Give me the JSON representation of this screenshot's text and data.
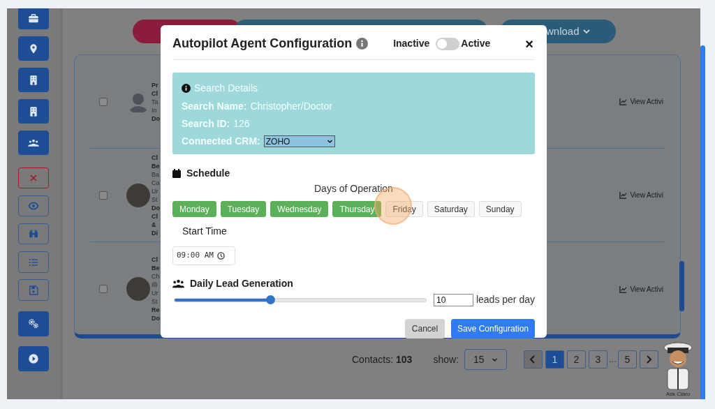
{
  "sidebar": {
    "items": [
      {
        "kind": "filled"
      },
      {
        "kind": "filled"
      },
      {
        "kind": "filled"
      },
      {
        "kind": "filled"
      },
      {
        "kind": "filled"
      },
      {
        "kind": "danger"
      },
      {
        "kind": "outlined"
      },
      {
        "kind": "outlined"
      },
      {
        "kind": "outlined"
      },
      {
        "kind": "outlined"
      },
      {
        "kind": "filled"
      },
      {
        "kind": "filled"
      }
    ]
  },
  "toolbar": {
    "buttons": [
      {
        "kind": "danger"
      },
      {
        "kind": "primary"
      },
      {
        "kind": "download",
        "label": "wnload"
      }
    ]
  },
  "contacts": {
    "rows": [
      {
        "checked": false,
        "kind": "silhouette",
        "lines": [
          {
            "text": "Pr",
            "bold": true
          },
          {
            "text": "Cl",
            "bold": true
          },
          {
            "text": "Ta",
            "bold": false
          },
          {
            "text": "In",
            "bold": false
          },
          {
            "text": "Do",
            "bold": true
          }
        ],
        "action": "View Activi"
      },
      {
        "checked": false,
        "kind": "photo",
        "lines": [
          {
            "text": "Cl",
            "bold": true
          },
          {
            "text": "Be",
            "bold": true
          },
          {
            "text": "Ba",
            "bold": false
          },
          {
            "text": "Ca",
            "bold": false
          },
          {
            "text": "Ur",
            "bold": false
          },
          {
            "text": "St",
            "bold": false
          },
          {
            "text": "Do",
            "bold": true
          },
          {
            "text": "Cl",
            "bold": true
          },
          {
            "text": "&",
            "bold": true
          },
          {
            "text": "Di",
            "bold": true
          }
        ],
        "action": "View Activi"
      },
      {
        "checked": false,
        "kind": "photo",
        "lines": [
          {
            "text": "Cl",
            "bold": true
          },
          {
            "text": "Be",
            "bold": true
          },
          {
            "text": "Ch",
            "bold": false
          },
          {
            "text": "Illi",
            "bold": false
          },
          {
            "text": "Ur",
            "bold": false
          },
          {
            "text": "St",
            "bold": false
          },
          {
            "text": "Re",
            "bold": true
          },
          {
            "text": "Do",
            "bold": true
          }
        ],
        "action": "View Activi"
      }
    ]
  },
  "footer": {
    "contacts_label": "Contacts: **103**",
    "show_label": "show:",
    "page_size": "15",
    "pages": [
      {
        "label": "1",
        "selected": true
      },
      {
        "label": "2",
        "selected": false
      },
      {
        "label": "3",
        "selected": false
      },
      {
        "label": "...",
        "kind": "ellipsis"
      },
      {
        "label": "5",
        "selected": false
      }
    ]
  },
  "assistant": {
    "caption": "Ask Claro"
  },
  "modal": {
    "title": "Autopilot Agent Configuration",
    "toggle": {
      "off_label": "Inactive",
      "on_label": "Active",
      "on": false
    },
    "close": "×",
    "search_details": {
      "title": "Search Details",
      "fields": [
        {
          "kind": "text",
          "label": "Search Name:",
          "value": "Christopher/Doctor"
        },
        {
          "kind": "text",
          "label": "Search ID:",
          "value": "126"
        },
        {
          "kind": "select",
          "label": "Connected CRM:",
          "value": "ZOHO"
        }
      ]
    },
    "schedule": {
      "title": "Schedule",
      "days_label": "Days of Operation",
      "days": [
        {
          "label": "Monday",
          "selected": true
        },
        {
          "label": "Tuesday",
          "selected": true
        },
        {
          "label": "Wednesday",
          "selected": true
        },
        {
          "label": "Thursday",
          "selected": true
        },
        {
          "label": "Friday",
          "selected": false,
          "highlighted": true
        },
        {
          "label": "Saturday",
          "selected": false
        },
        {
          "label": "Sunday",
          "selected": false
        }
      ],
      "start_label": "Start Time",
      "start_time": "09:00 AM"
    },
    "leads": {
      "title": "Daily Lead Generation",
      "level": 0.38,
      "value": "10",
      "unit": "leads per day"
    },
    "buttons": [
      {
        "kind": "secondary",
        "label": "Cancel"
      },
      {
        "kind": "primary",
        "label": "Save Configuration"
      }
    ]
  }
}
